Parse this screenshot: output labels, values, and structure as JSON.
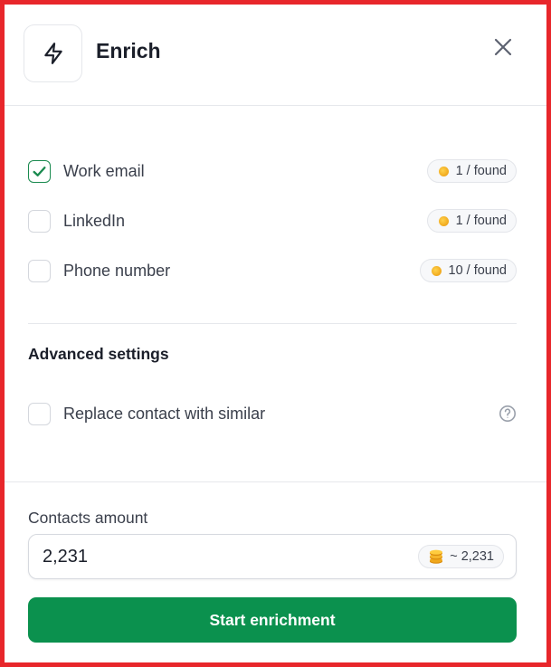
{
  "header": {
    "title": "Enrich",
    "icon": "lightning-bolt-icon",
    "close_icon": "close-icon"
  },
  "options": [
    {
      "label": "Work email",
      "checked": true,
      "cost": "1 / found"
    },
    {
      "label": "LinkedIn",
      "checked": false,
      "cost": "1 / found"
    },
    {
      "label": "Phone number",
      "checked": false,
      "cost": "10 / found"
    }
  ],
  "advanced": {
    "title": "Advanced settings",
    "replace_label": "Replace contact with similar",
    "replace_checked": false,
    "help_icon": "question-circle-icon"
  },
  "contacts": {
    "label": "Contacts amount",
    "value": "2,231",
    "estimate": "~ 2,231"
  },
  "actions": {
    "start_label": "Start enrichment"
  },
  "colors": {
    "frame": "#e8262b",
    "primary": "#0b914e",
    "check": "#1a8a4f",
    "coin": "#f0a81c"
  }
}
